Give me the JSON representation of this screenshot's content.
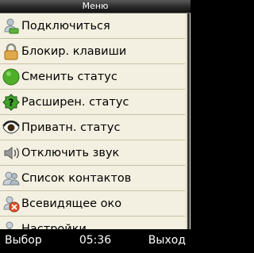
{
  "title": "Меню",
  "items": [
    {
      "label": "Подключиться",
      "icon": "user-connect-icon"
    },
    {
      "label": "Блокир. клавиши",
      "icon": "lock-icon"
    },
    {
      "label": "Сменить статус",
      "icon": "green-status-icon"
    },
    {
      "label": "Расширен. статус",
      "icon": "extended-status-icon"
    },
    {
      "label": "Приватн. статус",
      "icon": "eye-icon"
    },
    {
      "label": "Отключить звук",
      "icon": "speaker-icon"
    },
    {
      "label": "Список контактов",
      "icon": "contacts-icon"
    },
    {
      "label": "Всевидящее око",
      "icon": "all-seeing-eye-icon"
    },
    {
      "label": "Настройки",
      "icon": "settings-icon"
    }
  ],
  "softkeys": {
    "left": "Выбор",
    "center": "05:36",
    "right": "Выход"
  }
}
